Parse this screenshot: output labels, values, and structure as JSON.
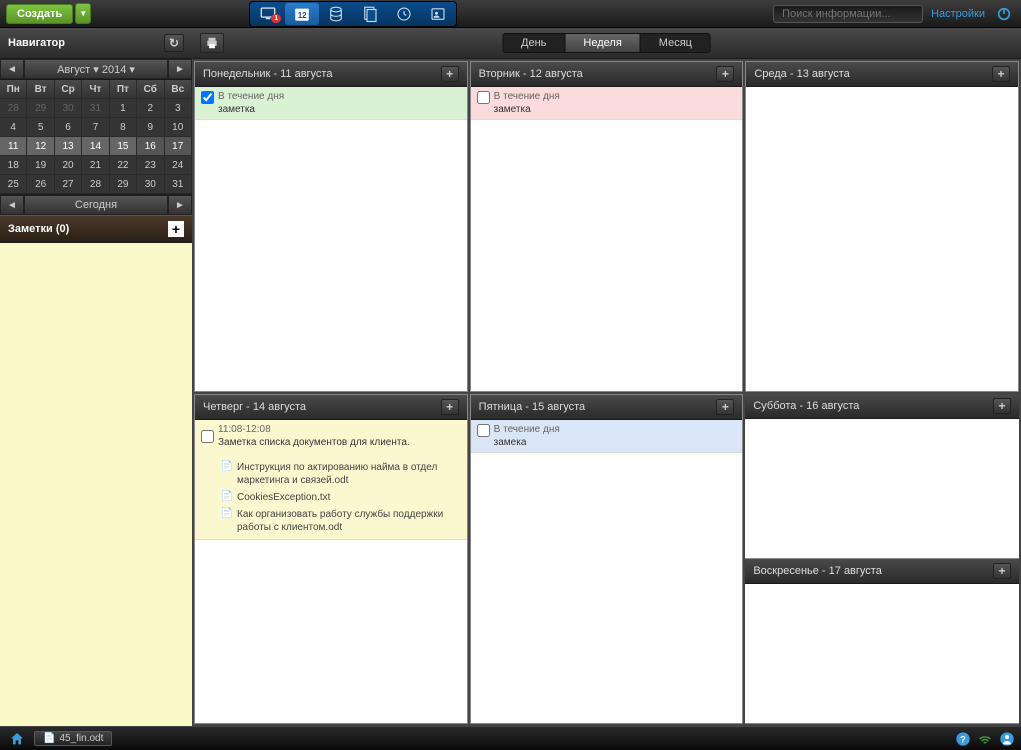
{
  "topbar": {
    "create_label": "Создать",
    "search_placeholder": "Поиск информации...",
    "settings_label": "Настройки",
    "calendar_badge": "12"
  },
  "navigator": {
    "title": "Навигатор",
    "month_label": "Август ▾ 2014 ▾",
    "today_label": "Сегодня",
    "day_headers": [
      "Пн",
      "Вт",
      "Ср",
      "Чт",
      "Пт",
      "Сб",
      "Вс"
    ],
    "weeks": [
      [
        {
          "d": "28",
          "dim": true
        },
        {
          "d": "29",
          "dim": true
        },
        {
          "d": "30",
          "dim": true
        },
        {
          "d": "31",
          "dim": true
        },
        {
          "d": "1"
        },
        {
          "d": "2"
        },
        {
          "d": "3"
        }
      ],
      [
        {
          "d": "4"
        },
        {
          "d": "5"
        },
        {
          "d": "6"
        },
        {
          "d": "7"
        },
        {
          "d": "8"
        },
        {
          "d": "9"
        },
        {
          "d": "10"
        }
      ],
      [
        {
          "d": "11",
          "hl": true
        },
        {
          "d": "12",
          "hl": true
        },
        {
          "d": "13",
          "hl": true
        },
        {
          "d": "14",
          "hl": true
        },
        {
          "d": "15",
          "hl": true
        },
        {
          "d": "16",
          "hl2": true
        },
        {
          "d": "17",
          "hl2": true
        }
      ],
      [
        {
          "d": "18"
        },
        {
          "d": "19"
        },
        {
          "d": "20"
        },
        {
          "d": "21"
        },
        {
          "d": "22"
        },
        {
          "d": "23"
        },
        {
          "d": "24"
        }
      ],
      [
        {
          "d": "25"
        },
        {
          "d": "26"
        },
        {
          "d": "27"
        },
        {
          "d": "28"
        },
        {
          "d": "29"
        },
        {
          "d": "30"
        },
        {
          "d": "31"
        }
      ]
    ]
  },
  "notes": {
    "header": "Заметки (0)"
  },
  "view_tabs": {
    "day": "День",
    "week": "Неделя",
    "month": "Месяц"
  },
  "days": {
    "mon": {
      "title": "Понедельник - 11 августа",
      "event_time": "В течение дня",
      "event_note": "заметка",
      "checked": true
    },
    "tue": {
      "title": "Вторник - 12 августа",
      "event_time": "В течение дня",
      "event_note": "заметка",
      "checked": false
    },
    "wed": {
      "title": "Среда - 13 августа"
    },
    "thu": {
      "title": "Четверг - 14 августа",
      "event_time": "11:08-12:08",
      "event_note": "Заметка списка документов для клиента.",
      "attachments": [
        "Инструкция по актированию найма в отдел маркетинга и связей.odt",
        "CookiesException.txt",
        "Как организовать работу службы поддержки работы с клиентом.odt"
      ]
    },
    "fri": {
      "title": "Пятница - 15 августа",
      "event_time": "В течение дня",
      "event_note": "замека",
      "checked": false
    },
    "sat": {
      "title": "Суббота - 16 августа"
    },
    "sun": {
      "title": "Воскресенье - 17 августа"
    }
  },
  "bottombar": {
    "task": "45_fin.odt"
  }
}
